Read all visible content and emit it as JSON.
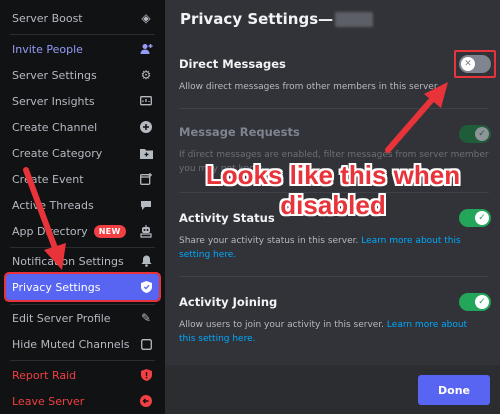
{
  "menu": {
    "items": [
      {
        "label": "Server Boost",
        "icon": "boost-gem-icon",
        "glyph": "◈"
      },
      {
        "label": "Invite People",
        "icon": "add-person-icon",
        "glyph": "⁺👤"
      },
      {
        "label": "Server Settings",
        "icon": "gear-icon",
        "glyph": "⚙"
      },
      {
        "label": "Server Insights",
        "icon": "insights-icon",
        "glyph": "▣"
      },
      {
        "label": "Create Channel",
        "icon": "plus-circle-icon",
        "glyph": "⊕"
      },
      {
        "label": "Create Category",
        "icon": "folder-plus-icon",
        "glyph": "▰"
      },
      {
        "label": "Create Event",
        "icon": "calendar-plus-icon",
        "glyph": "▦"
      },
      {
        "label": "Active Threads",
        "icon": "threads-icon",
        "glyph": "▬"
      },
      {
        "label": "App Directory",
        "badge": "NEW",
        "icon": "robot-icon",
        "glyph": "☗"
      },
      {
        "label": "Notification Settings",
        "icon": "bell-icon",
        "glyph": "🔔"
      },
      {
        "label": "Privacy Settings",
        "icon": "shield-icon",
        "glyph": "⛨"
      },
      {
        "label": "Edit Server Profile",
        "icon": "pencil-icon",
        "glyph": "✎"
      },
      {
        "label": "Hide Muted Channels",
        "icon": "checkbox-icon",
        "glyph": "☐"
      },
      {
        "label": "Report Raid",
        "icon": "shield-alert-icon",
        "glyph": "⛊"
      },
      {
        "label": "Leave Server",
        "icon": "leave-icon",
        "glyph": "⬅"
      }
    ]
  },
  "main": {
    "title": "Privacy Settings—",
    "sections": [
      {
        "title": "Direct Messages",
        "desc": "Allow direct messages from other members in this server.",
        "toggle": "off"
      },
      {
        "title": "Message Requests",
        "desc_line1": "If direct messages are enabled, filter messages from server members",
        "desc_line2": "you may not know.",
        "toggle": "on-disabled"
      },
      {
        "title": "Activity Status",
        "desc": "Share your activity status in this server.",
        "link": "Learn more about this setting here.",
        "toggle": "on"
      },
      {
        "title": "Activity Joining",
        "desc": "Allow users to join your activity in this server.",
        "link": "Learn more about this setting here.",
        "toggle": "on"
      }
    ],
    "done_label": "Done"
  },
  "annotation": {
    "callout": "Looks like this when disabled",
    "color": "#e8333a"
  },
  "colors": {
    "accent": "#5865f2",
    "toggle_on": "#23a55a",
    "link": "#00a8fc",
    "danger": "#f23f43"
  }
}
